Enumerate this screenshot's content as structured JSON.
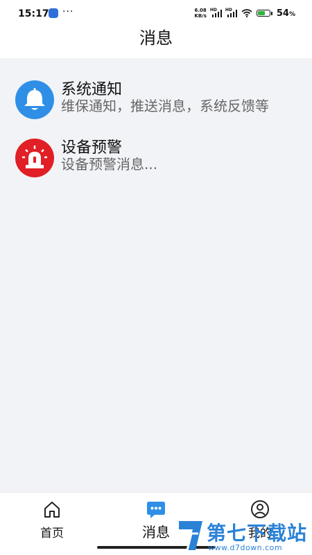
{
  "status_bar": {
    "time": "15:17",
    "more": "···",
    "speed_value": "6.08",
    "speed_unit": "KB/s",
    "hd1": "HD",
    "hd2": "HD",
    "battery_percent": "54",
    "battery_percent_sign": "%",
    "battery_level": 0.54,
    "battery_color": "#2db33d"
  },
  "header": {
    "title": "消息"
  },
  "messages": [
    {
      "title": "系统通知",
      "subtitle": "维保通知，推送消息，系统反馈等",
      "icon": "bell-icon",
      "color": "#2f8fe6"
    },
    {
      "title": "设备预警",
      "subtitle": "设备预警消息...",
      "icon": "alarm-siren-icon",
      "color": "#e11f26"
    }
  ],
  "tabbar": {
    "tabs": [
      {
        "label": "首页",
        "icon": "home-icon",
        "active": false
      },
      {
        "label": "消息",
        "icon": "chat-bubble-icon",
        "active": true
      },
      {
        "label": "我的",
        "icon": "user-icon",
        "active": false
      }
    ],
    "accent": "#2f8fe6"
  },
  "watermark": {
    "text": "第七下载站",
    "url": "www.d7down.com"
  }
}
